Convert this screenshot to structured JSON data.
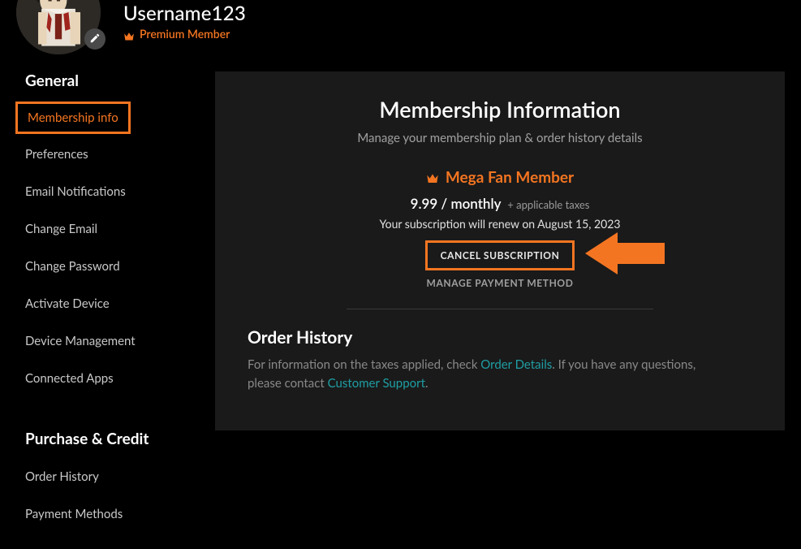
{
  "user": {
    "name": "Username123",
    "premium_label": "Premium Member"
  },
  "sidebar": {
    "section1_title": "General",
    "items": [
      "Membership info",
      "Preferences",
      "Email Notifications",
      "Change Email",
      "Change Password",
      "Activate Device",
      "Device Management",
      "Connected Apps"
    ],
    "section2_title": "Purchase & Credit",
    "items2": [
      "Order History",
      "Payment Methods"
    ]
  },
  "panel": {
    "title": "Membership Information",
    "subtitle": "Manage your membership plan & order history details",
    "plan_name": "Mega Fan Member",
    "price": "9.99 / monthly",
    "tax_note": "+ applicable taxes",
    "renewal": "Your subscription will renew on August 15, 2023",
    "cancel_label": "CANCEL SUBSCRIPTION",
    "manage_label": "MANAGE PAYMENT METHOD",
    "order_title": "Order History",
    "order_text_1": "For information on the taxes applied, check ",
    "order_link_1": "Order Details",
    "order_text_2": ". If you have any questions, please contact ",
    "order_link_2": "Customer Support",
    "order_text_3": "."
  },
  "colors": {
    "accent": "#f47521",
    "link": "#1f9ea3"
  }
}
